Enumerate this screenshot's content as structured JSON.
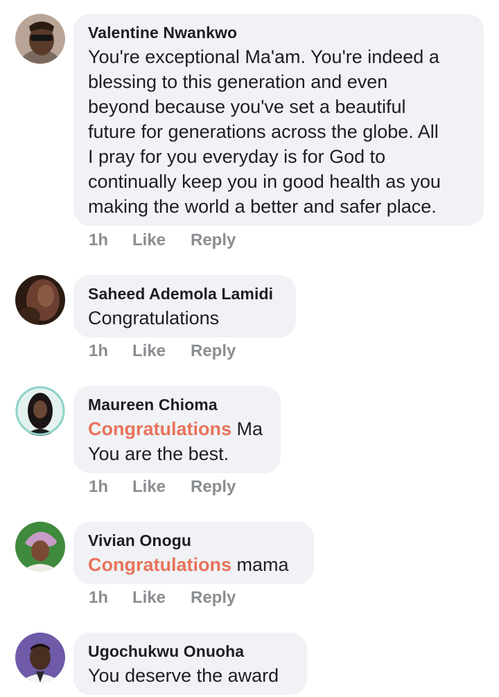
{
  "comments": [
    {
      "author": "Valentine Nwankwo",
      "text": "You're exceptional Ma'am. You're indeed a\nblessing to this generation and even\nbeyond because you've set a beautiful\nfuture for generations across the globe. All\nI pray for you everyday is for God to\ncontinually keep you in good health as you\nmaking the world a better and safer place.",
      "time": "1h",
      "like": "Like",
      "reply": "Reply"
    },
    {
      "author": "Saheed Ademola Lamidi",
      "text": "Congratulations",
      "time": "1h",
      "like": "Like",
      "reply": "Reply"
    },
    {
      "author": "Maureen Chioma",
      "highlight": "Congratulations",
      "text": " Ma\nYou are the best.",
      "time": "1h",
      "like": "Like",
      "reply": "Reply"
    },
    {
      "author": "Vivian Onogu",
      "highlight": "Congratulations",
      "text": " mama",
      "time": "1h",
      "like": "Like",
      "reply": "Reply"
    },
    {
      "author": "Ugochukwu Onuoha",
      "text": "You deserve the award"
    }
  ],
  "colors": {
    "bubble": "#f0f2f5",
    "highlight": "#e8735a",
    "meta": "#8a8d91"
  }
}
